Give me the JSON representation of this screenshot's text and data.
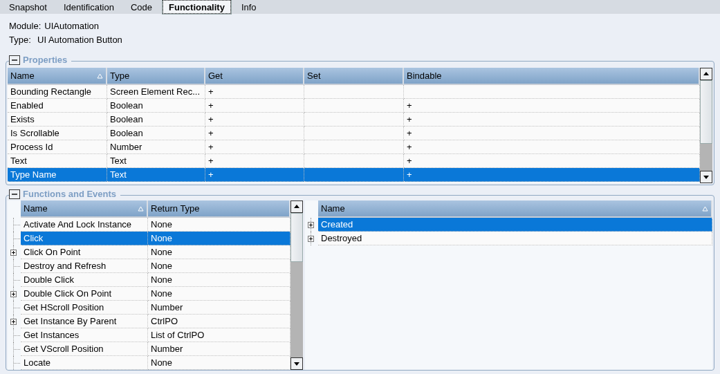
{
  "tabs": [
    {
      "label": "Snapshot",
      "selected": false
    },
    {
      "label": "Identification",
      "selected": false
    },
    {
      "label": "Code",
      "selected": false
    },
    {
      "label": "Functionality",
      "selected": true
    },
    {
      "label": "Info",
      "selected": false
    }
  ],
  "module": {
    "label": "Module:",
    "value": "UIAutomation"
  },
  "type": {
    "label": "Type:",
    "value": "UI Automation Button"
  },
  "properties": {
    "title": "Properties",
    "expanded": true,
    "columns": [
      {
        "label": "Name",
        "sorted": true
      },
      {
        "label": "Type",
        "sorted": false
      },
      {
        "label": "Get",
        "sorted": false
      },
      {
        "label": "Set",
        "sorted": false
      },
      {
        "label": "Bindable",
        "sorted": false
      }
    ],
    "rows": [
      {
        "cells": [
          "Bounding Rectangle",
          "Screen Element Rec...",
          "+",
          "",
          ""
        ],
        "selected": false
      },
      {
        "cells": [
          "Enabled",
          "Boolean",
          "+",
          "",
          "+"
        ],
        "selected": false
      },
      {
        "cells": [
          "Exists",
          "Boolean",
          "+",
          "",
          "+"
        ],
        "selected": false
      },
      {
        "cells": [
          "Is Scrollable",
          "Boolean",
          "+",
          "",
          "+"
        ],
        "selected": false
      },
      {
        "cells": [
          "Process Id",
          "Number",
          "+",
          "",
          "+"
        ],
        "selected": false
      },
      {
        "cells": [
          "Text",
          "Text",
          "+",
          "",
          "+"
        ],
        "selected": false
      },
      {
        "cells": [
          "Type Name",
          "Text",
          "+",
          "",
          "+"
        ],
        "selected": true
      }
    ]
  },
  "functions_and_events": {
    "title": "Functions and Events",
    "expanded": true,
    "functions": {
      "columns": [
        {
          "label": "Name",
          "sorted": true
        },
        {
          "label": "Return Type",
          "sorted": false
        }
      ],
      "rows": [
        {
          "name": "Activate And Lock Instance",
          "return_type": "None",
          "expandable": false,
          "selected": false
        },
        {
          "name": "Click",
          "return_type": "None",
          "expandable": false,
          "selected": true
        },
        {
          "name": "Click On Point",
          "return_type": "None",
          "expandable": true,
          "selected": false
        },
        {
          "name": "Destroy and Refresh",
          "return_type": "None",
          "expandable": false,
          "selected": false
        },
        {
          "name": "Double Click",
          "return_type": "None",
          "expandable": false,
          "selected": false
        },
        {
          "name": "Double Click On Point",
          "return_type": "None",
          "expandable": true,
          "selected": false
        },
        {
          "name": "Get HScroll Position",
          "return_type": "Number",
          "expandable": false,
          "selected": false
        },
        {
          "name": "Get Instance By Parent",
          "return_type": "CtrlPO",
          "expandable": true,
          "selected": false
        },
        {
          "name": "Get Instances",
          "return_type": "List of CtrlPO",
          "expandable": false,
          "selected": false
        },
        {
          "name": "Get VScroll Position",
          "return_type": "Number",
          "expandable": false,
          "selected": false
        },
        {
          "name": "Locate",
          "return_type": "None",
          "expandable": false,
          "selected": false
        }
      ]
    },
    "events": {
      "columns": [
        {
          "label": "Name",
          "sorted": true
        }
      ],
      "rows": [
        {
          "name": "Created",
          "expandable": true,
          "selected": true
        },
        {
          "name": "Destroyed",
          "expandable": true,
          "selected": false
        }
      ]
    }
  }
}
